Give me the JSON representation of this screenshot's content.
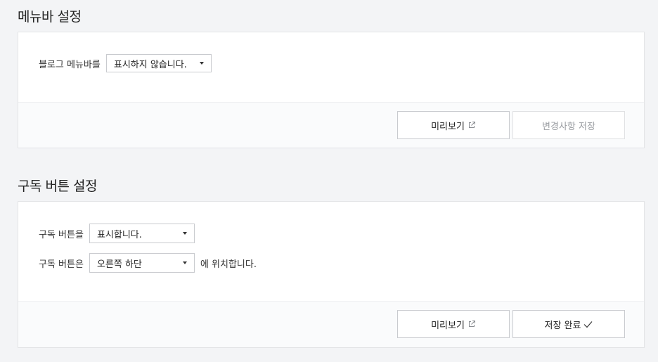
{
  "menubar": {
    "title": "메뉴바 설정",
    "label": "블로그 메뉴바를",
    "select_value": "표시하지 않습니다.",
    "preview_label": "미리보기",
    "save_label": "변경사항 저장"
  },
  "subscribe": {
    "title": "구독 버튼 설정",
    "show_label": "구독 버튼을",
    "show_value": "표시합니다.",
    "position_label": "구독 버튼은",
    "position_value": "오른쪽 하단",
    "position_suffix": "에 위치합니다.",
    "preview_label": "미리보기",
    "save_label": "저장 완료"
  },
  "icons": {
    "external_link": "external-link-icon",
    "check": "check-icon",
    "dropdown": "caret-down-icon"
  }
}
